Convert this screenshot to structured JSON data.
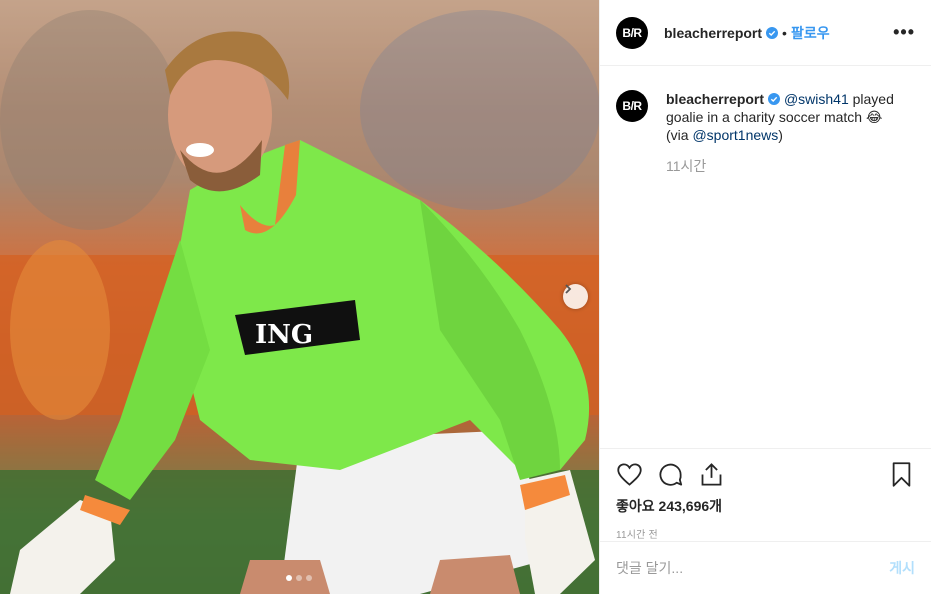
{
  "post": {
    "carousel_dots": 3,
    "active_dot": 0
  },
  "header": {
    "logo_text": "B/R",
    "username": "bleacherreport",
    "separator": "•",
    "follow_label": "팔로우",
    "more_label": "•••"
  },
  "caption": {
    "username": "bleacherreport",
    "mention1": "@swish41",
    "text1": " played goalie in a charity soccer match 😂",
    "text2": "(via ",
    "mention2": "@sport1news",
    "text3": ")",
    "age": "11시간"
  },
  "actions": {
    "likes_label": "좋아요 243,696개",
    "timestamp": "11시간 전"
  },
  "comment": {
    "placeholder": "댓글 달기...",
    "post_label": "게시"
  },
  "colors": {
    "accent": "#3897f0",
    "verified": "#3897f0",
    "jersey": "#7ee84a"
  }
}
